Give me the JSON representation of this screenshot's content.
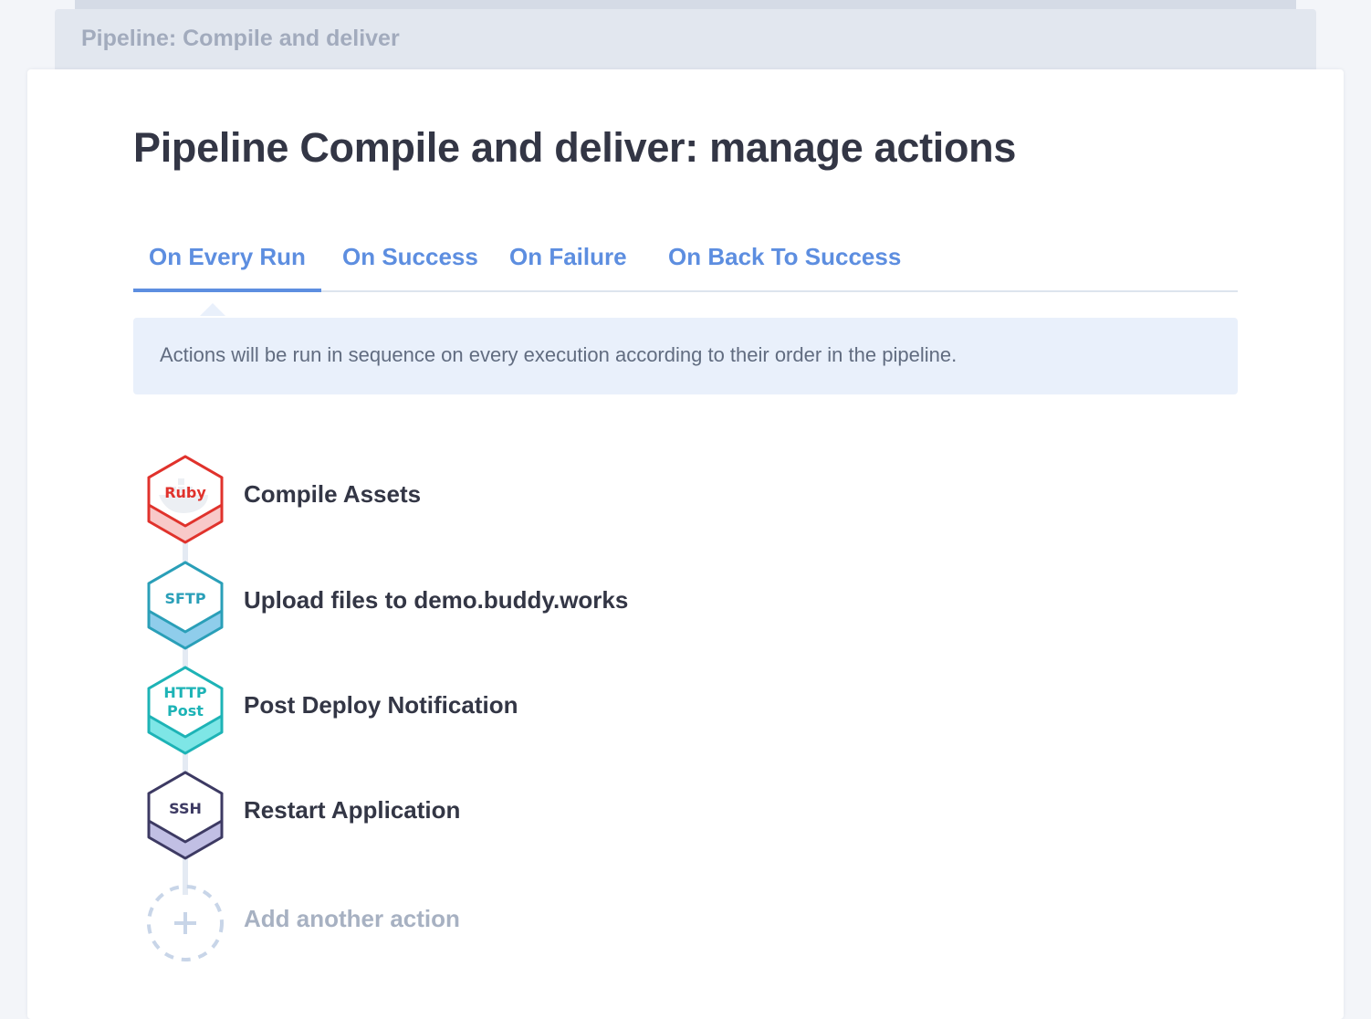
{
  "background_stack": {
    "title": "Pipeline: Compile and deliver"
  },
  "page": {
    "title": "Pipeline Compile and deliver: manage actions"
  },
  "tabs": [
    {
      "label": "On Every Run",
      "active": true
    },
    {
      "label": "On Success",
      "active": false
    },
    {
      "label": "On Failure",
      "active": false
    },
    {
      "label": "On Back To Success",
      "active": false
    }
  ],
  "info": {
    "text": "Actions will be run in sequence on every execution according to their order in the pipeline."
  },
  "actions": [
    {
      "label": "Compile Assets",
      "icon": "ruby-docker-icon",
      "badge": "Ruby",
      "color": "#e0322c",
      "fill": "#f8c9c9"
    },
    {
      "label": "Upload files to demo.buddy.works",
      "icon": "sftp-icon",
      "badge": "SFTP",
      "color": "#2a9fb8",
      "fill": "#8fcdeb"
    },
    {
      "label": "Post Deploy Notification",
      "icon": "http-post-icon",
      "badge_line1": "HTTP",
      "badge_line2": "Post",
      "color": "#1db3b6",
      "fill": "#7ee6e6"
    },
    {
      "label": "Restart Application",
      "icon": "ssh-icon",
      "badge": "SSH",
      "color": "#3d3a63",
      "fill": "#c1bfe4"
    }
  ],
  "add_action": {
    "label": "Add another action",
    "icon": "plus-icon",
    "color": "#c8d5e8"
  },
  "colors": {
    "accent": "#5d8ee0",
    "title_text": "#333645",
    "info_bg": "#e9f0fb"
  }
}
